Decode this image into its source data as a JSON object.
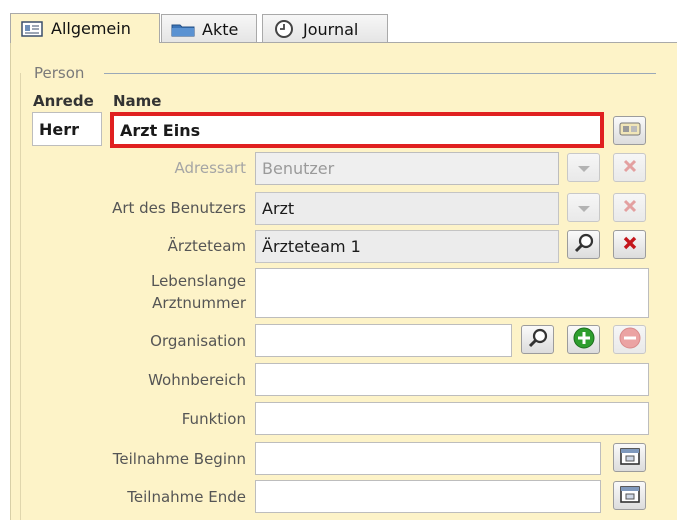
{
  "tabs": [
    {
      "label": "Allgemein",
      "icon": "card-icon"
    },
    {
      "label": "Akte",
      "icon": "folder-icon"
    },
    {
      "label": "Journal",
      "icon": "clock-icon"
    }
  ],
  "group": {
    "title": "Person"
  },
  "headers": {
    "anrede": "Anrede",
    "name": "Name"
  },
  "person": {
    "anrede": "Herr",
    "name": "Arzt Eins"
  },
  "fields": {
    "adressart": {
      "label": "Adressart",
      "value": "Benutzer"
    },
    "art_des_benutzers": {
      "label": "Art des Benutzers",
      "value": "Arzt"
    },
    "aerzteteam": {
      "label": "Ärzteteam",
      "value": "Ärzteteam 1"
    },
    "lebenslange_arztnummer": {
      "label_line1": "Lebenslange",
      "label_line2": "Arztnummer",
      "value": ""
    },
    "organisation": {
      "label": "Organisation",
      "value": ""
    },
    "wohnbereich": {
      "label": "Wohnbereich",
      "value": ""
    },
    "funktion": {
      "label": "Funktion",
      "value": ""
    },
    "teilnahme_beginn": {
      "label": "Teilnahme Beginn",
      "value": ""
    },
    "teilnahme_ende": {
      "label": "Teilnahme Ende",
      "value": ""
    }
  },
  "colors": {
    "panel": "#fdf3c8",
    "highlight": "#e02020",
    "add": "#2e9e2e",
    "remove": "#d64545"
  }
}
